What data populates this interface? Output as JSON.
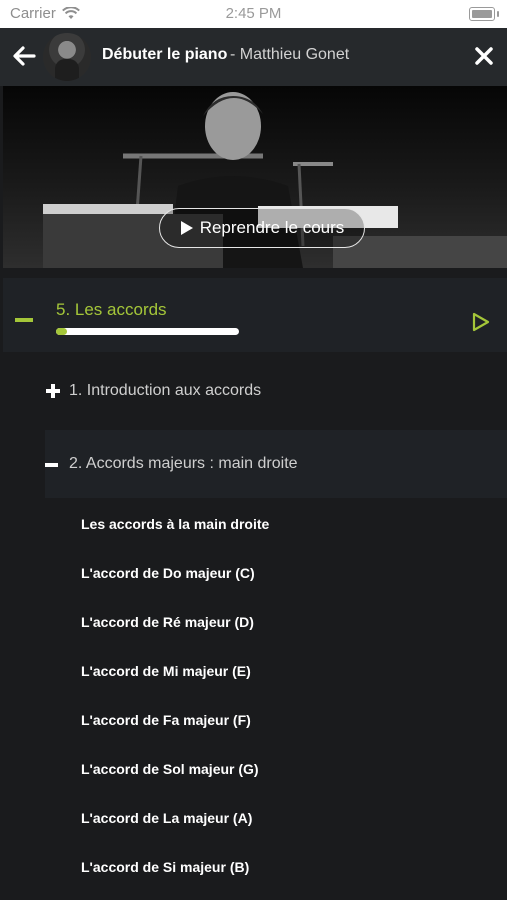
{
  "status_bar": {
    "carrier": "Carrier",
    "time": "2:45 PM"
  },
  "header": {
    "title": "Débuter le piano",
    "subtitle": "- Matthieu Gonet"
  },
  "video": {
    "resume_label": "Reprendre le cours"
  },
  "chapter": {
    "title": "5. Les accords",
    "progress": 0.06,
    "accent": "#a4c639"
  },
  "lessons": [
    {
      "label": "1. Introduction aux accords",
      "state": "collapsed"
    },
    {
      "label": "2. Accords majeurs : main droite",
      "state": "expanded"
    }
  ],
  "sub_lessons": [
    "Les accords à la main droite",
    "L'accord de Do majeur (C)",
    "L'accord de Ré majeur (D)",
    "L'accord de Mi majeur (E)",
    "L'accord de Fa majeur (F)",
    "L'accord de Sol majeur (G)",
    "L'accord de La majeur (A)",
    "L'accord de Si majeur (B)"
  ]
}
